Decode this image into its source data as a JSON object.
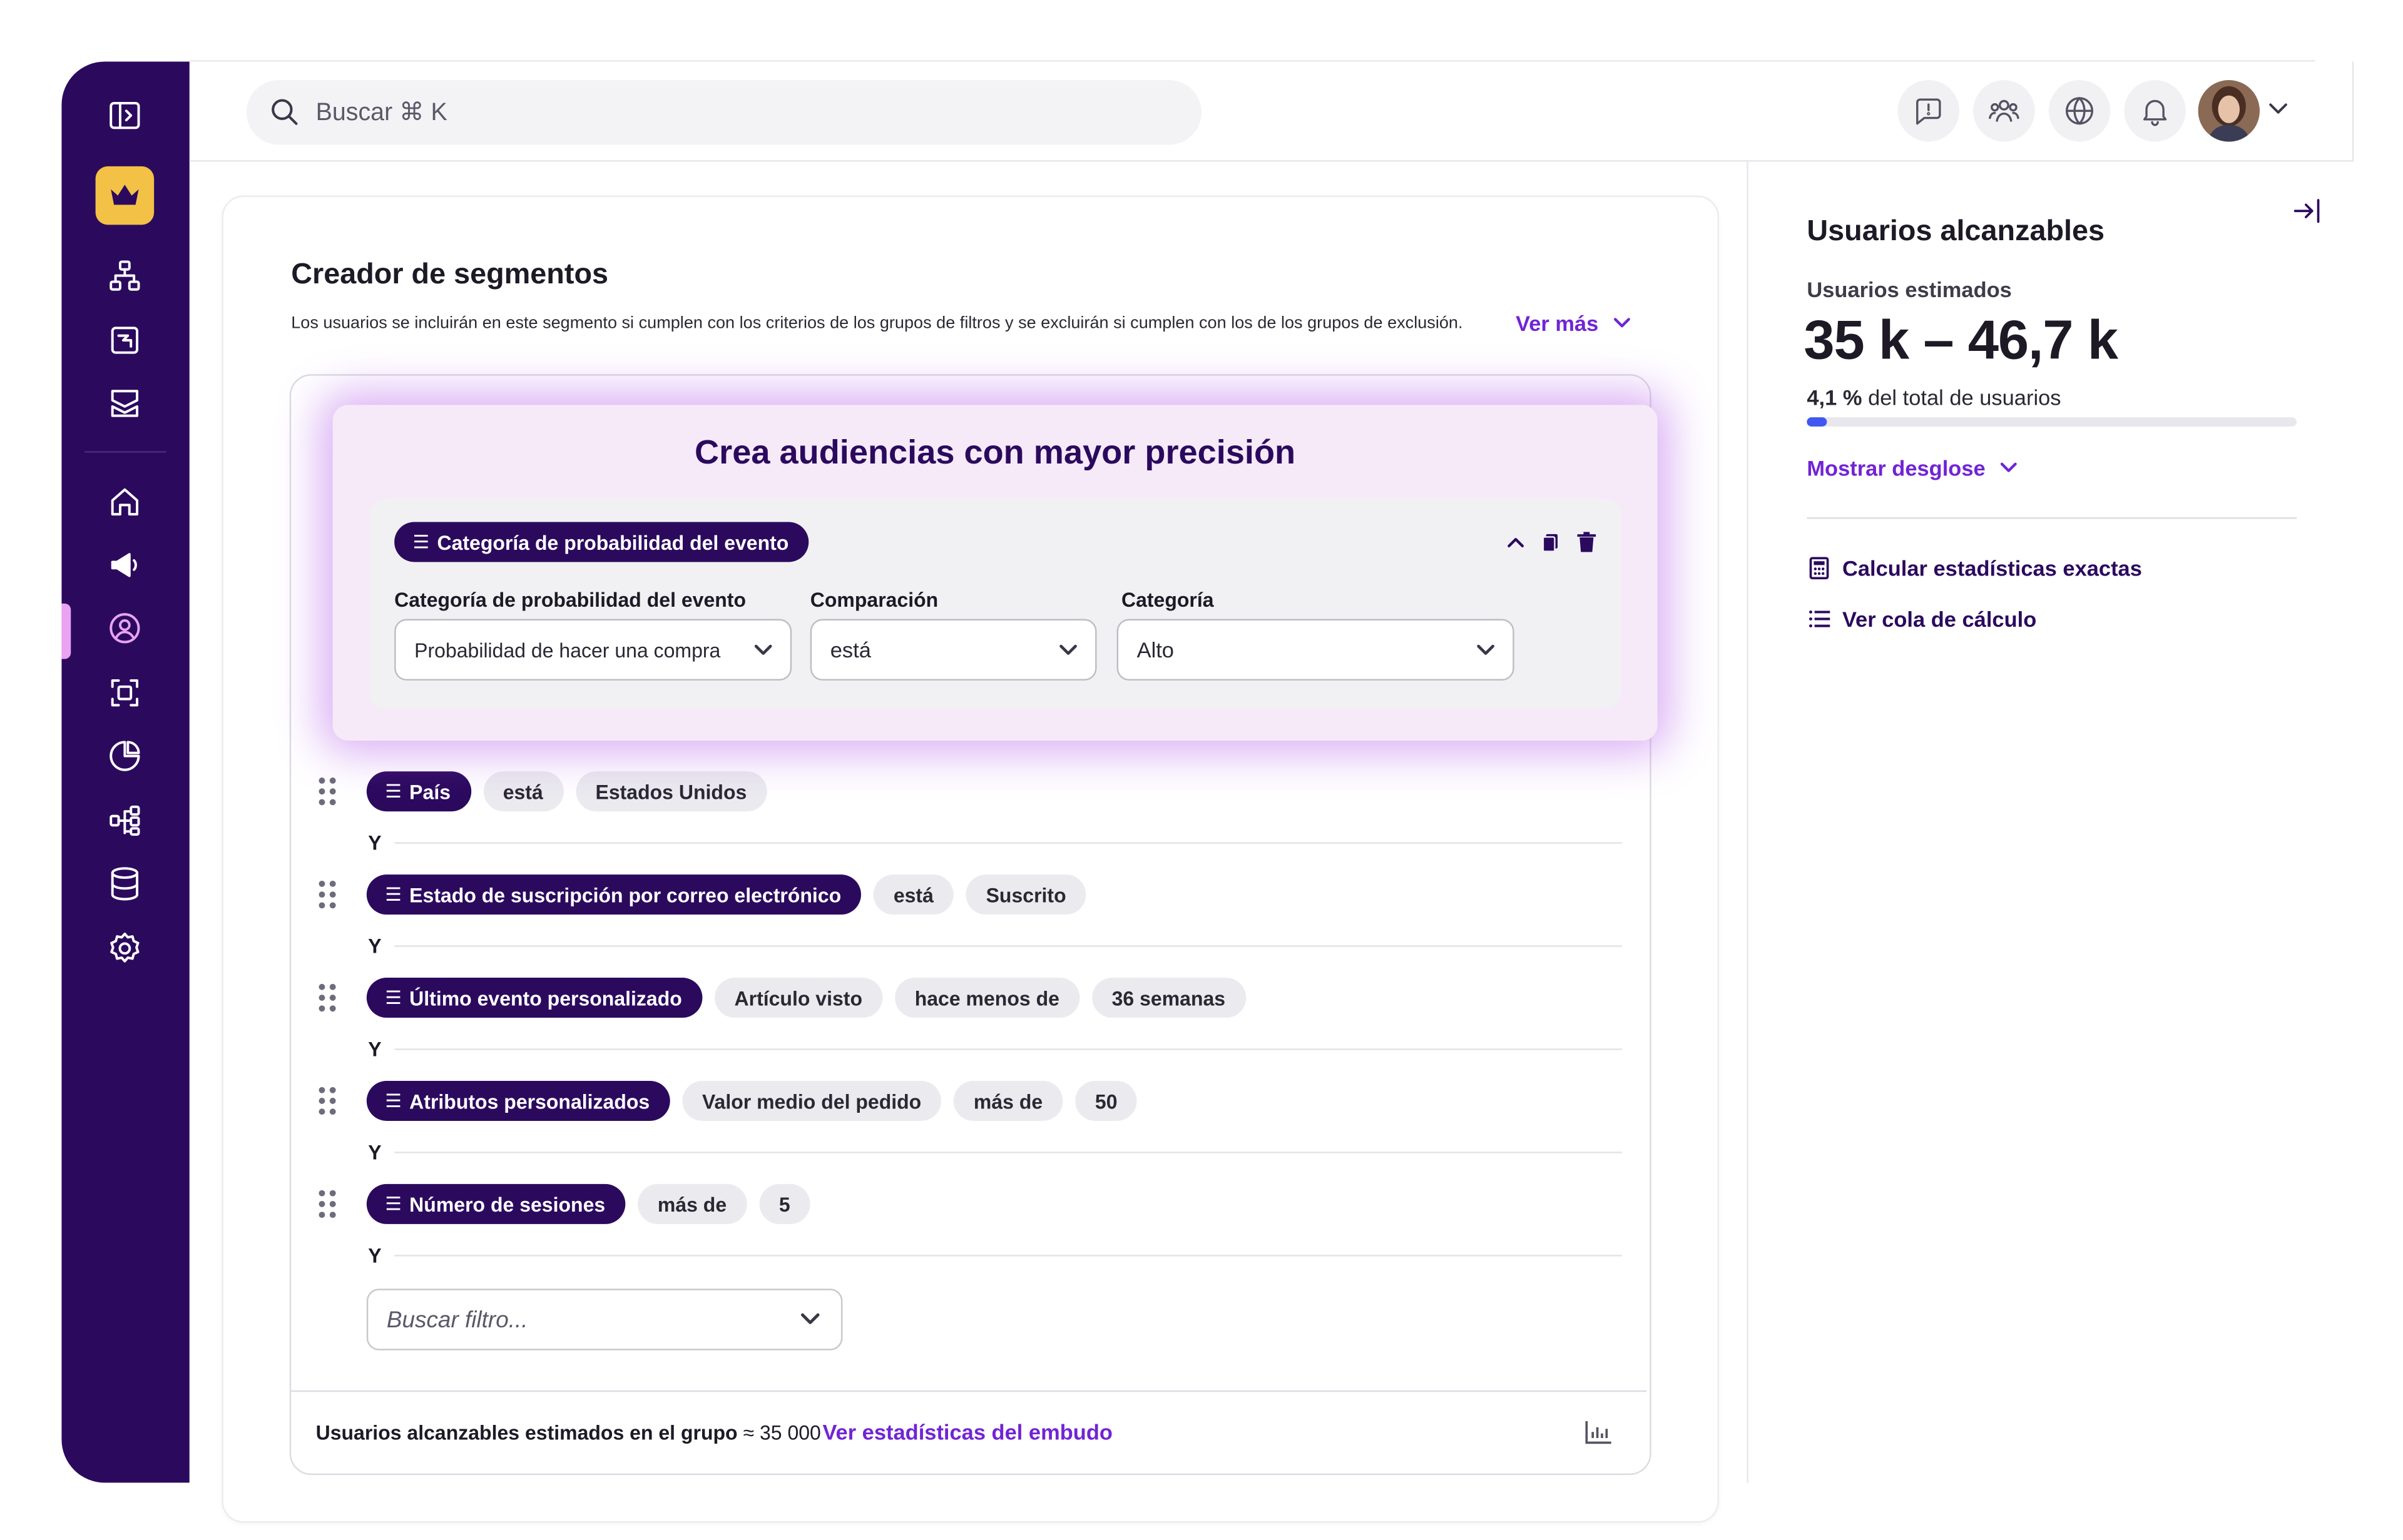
{
  "search": {
    "placeholder": "Buscar ⌘ K"
  },
  "header": {
    "icons": [
      "alert-icon",
      "users-icon",
      "globe-icon",
      "bell-icon"
    ],
    "avatar": "avatar"
  },
  "sidebar": {
    "icons": [
      "sidebar-toggle-icon",
      "crown-icon",
      "hierarchy-icon",
      "canvas-icon",
      "campaigns-icon",
      "home-icon",
      "megaphone-icon",
      "audience-icon",
      "scan-icon",
      "pie-chart-icon",
      "workflow-icon",
      "database-icon",
      "settings-icon"
    ],
    "active": "audience-icon"
  },
  "builder": {
    "title": "Creador de segmentos",
    "description": "Los usuarios se incluirán en este segmento si cumplen con los criterios de los grupos de filtros y se excluirán si cumplen con los de los grupos de exclusión.",
    "ver_mas": "Ver más",
    "rows": [
      {
        "filter": "País",
        "values": [
          "está",
          "Estados Unidos"
        ]
      },
      {
        "filter": "Estado de suscripción por correo electrónico",
        "values": [
          "está",
          "Suscrito"
        ]
      },
      {
        "filter": "Último evento personalizado",
        "values": [
          "Artículo visto",
          "hace menos de",
          "36 semanas"
        ]
      },
      {
        "filter": "Atributos personalizados",
        "values": [
          "Valor medio del pedido",
          "más de",
          "50"
        ]
      },
      {
        "filter": "Número de sesiones",
        "values": [
          "más de",
          "5"
        ]
      }
    ],
    "connector": "Y",
    "search_filter_placeholder": "Buscar filtro...",
    "footer_text": "Usuarios alcanzables estimados en el grupo",
    "footer_value": "≈ 35 000",
    "footer_link": "Ver estadísticas del embudo"
  },
  "overlay": {
    "title": "Crea audiencias con mayor precisión",
    "filter_pill": "Categoría de probabilidad del evento",
    "fields": [
      {
        "label": "Categoría de probabilidad del evento",
        "value": "Probabilidad de hacer una compra"
      },
      {
        "label": "Comparación",
        "value": "está"
      },
      {
        "label": "Categoría",
        "value": "Alto"
      }
    ]
  },
  "right_panel": {
    "title": "Usuarios alcanzables",
    "estimated_label": "Usuarios estimados",
    "estimated_range": "35 k – 46,7 k",
    "percent": "4,1 %",
    "percent_suffix": "del total de usuarios",
    "percent_value": 0.041,
    "show_breakdown": "Mostrar desglose",
    "actions": [
      "Calcular estadísticas exactas",
      "Ver cola de cálculo"
    ]
  },
  "colors": {
    "sidebar": "#2b0a5e",
    "accent": "#7124d4",
    "crown": "#f3c145",
    "progress": "#4058f0"
  }
}
